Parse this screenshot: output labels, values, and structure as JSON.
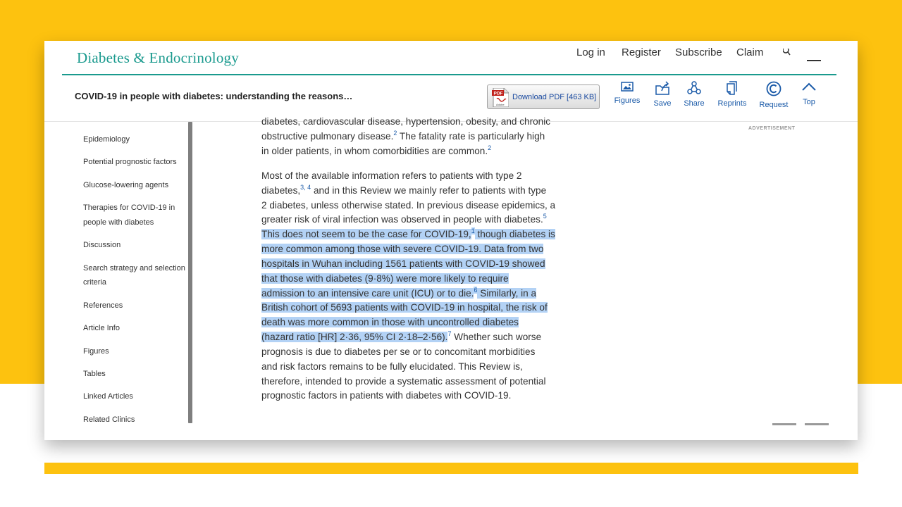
{
  "header": {
    "brand": "Diabetes & Endocrinology",
    "nav": [
      "Log in",
      "Register",
      "Subscribe",
      "Claim"
    ]
  },
  "toolbar": {
    "article_title": "COVID-19 in people with diabetes: understanding the reasons…",
    "pdf_label": "Download PDF [463 KB]",
    "tools": {
      "figures": "Figures",
      "save": "Save",
      "share": "Share",
      "reprints": "Reprints",
      "request": "Request",
      "top": "Top"
    }
  },
  "sidebar": {
    "items": [
      "Epidemiology",
      "Potential prognostic factors",
      "Glucose-lowering agents",
      "Therapies for COVID-19 in",
      "people with diabetes",
      "Discussion",
      "Search strategy and selection",
      "criteria",
      "References",
      "Article Info",
      "Figures",
      "Tables",
      "Linked Articles",
      "Related Clinics"
    ]
  },
  "advertisement_label": "ADVERTISEMENT",
  "article": {
    "p1": {
      "l1": "diabetes, cardiovascular disease, hypertension, obesity, and chronic",
      "l2a": "obstructive pulmonary disease.",
      "l2sup": "2",
      "l2b": " The fatality rate is particularly high",
      "l3a": "in older patients, in whom comorbidities are common.",
      "l3sup": "2"
    },
    "p2": {
      "l1": "Most of the available information refers to patients with type 2",
      "l2a": "diabetes,",
      "l2sup": "3, 4",
      "l2b": " and in this Review we mainly refer to patients with type",
      "l3": "2 diabetes, unless otherwise stated. In previous disease epidemics, a",
      "l4a": "greater risk of viral infection was observed in people with diabetes.",
      "l4sup": "5",
      "l5a": "This does not seem to be the case for COVID-19,",
      "l5sup": "1",
      "l5b": " though diabetes is",
      "l6": "more common among those with severe COVID-19. Data from two",
      "l7": "hospitals in Wuhan including 1561 patients with COVID-19 showed",
      "l8": "that those with diabetes (9·8%) were more likely to require",
      "l9a": "admission to an intensive care unit (ICU) or to die.",
      "l9sup": "6",
      "l9b": " Similarly, in a",
      "l10": "British cohort of 5693 patients with COVID-19 in hospital, the risk of",
      "l11": "death was more common in those with uncontrolled diabetes",
      "l12a": "(hazard ratio [HR] 2·36, 95% CI 2·18–2·56).",
      "l12sup": "7",
      "l12b": " Whether such worse",
      "l13": "prognosis is due to diabetes per se or to concomitant morbidities",
      "l14": "and risk factors remains to be fully elucidated. This Review is,",
      "l15": "therefore, intended to provide a systematic assessment of potential",
      "l16": "prognostic factors in patients with diabetes with COVID-19."
    }
  },
  "colors": {
    "brand_teal": "#1a9a8e",
    "link_blue": "#1a5aa8",
    "selection": "#b3d2f5",
    "background_yellow": "#fdc20f"
  },
  "icons": [
    "pdf-file-icon",
    "figures-image-icon",
    "save-folder-icon",
    "share-network-icon",
    "reprints-document-icon",
    "request-copyright-icon",
    "top-chevron-up-icon",
    "search-icon",
    "menu-icon"
  ]
}
